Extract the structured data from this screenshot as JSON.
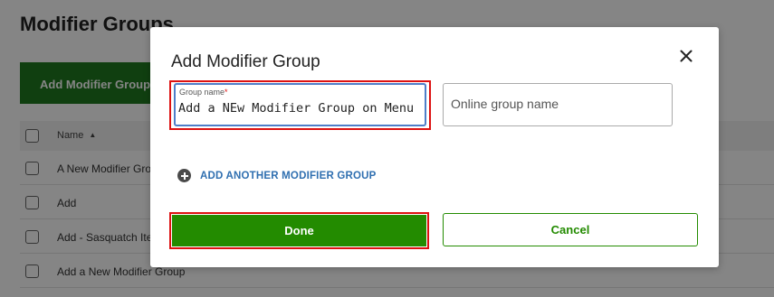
{
  "background": {
    "page_title": "Modifier Groups",
    "add_button_label": "Add Modifier Group",
    "table": {
      "header_name": "Name",
      "rows": [
        "A New Modifier Group",
        "Add",
        "Add - Sasquatch Items",
        "Add a New Modifier Group"
      ]
    }
  },
  "modal": {
    "title": "Add Modifier Group",
    "group_name": {
      "label": "Group name",
      "required_marker": "*",
      "value": "Add a NEw Modifier Group on Menu"
    },
    "online_group_name": {
      "placeholder": "Online group name",
      "value": ""
    },
    "add_another_label": "ADD ANOTHER MODIFIER GROUP",
    "done_label": "Done",
    "cancel_label": "Cancel"
  },
  "colors": {
    "primary_green": "#238b00",
    "link_blue": "#2f6fb0",
    "focus_blue": "#4f7ec9",
    "highlight_red": "#dd1111"
  },
  "icons": [
    "close-icon",
    "plus-circle-icon",
    "sort-ascending-icon",
    "checkbox-icon"
  ]
}
